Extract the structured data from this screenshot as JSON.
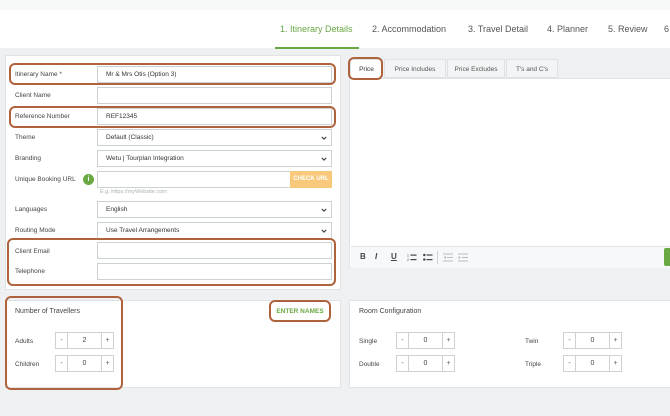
{
  "steps": [
    {
      "label": "1. Itinerary Details"
    },
    {
      "label": "2. Accommodation"
    },
    {
      "label": "3. Travel Detail"
    },
    {
      "label": "4. Planner"
    },
    {
      "label": "5. Review"
    },
    {
      "label": "6"
    }
  ],
  "form": {
    "itinerary_name_label": "Itinerary Name *",
    "itinerary_name_value": "Mr & Mrs Otis (Option 3)",
    "client_name_label": "Client Name",
    "reference_label": "Reference Number",
    "reference_value": "REF12345",
    "theme_label": "Theme",
    "theme_value": "Default (Classic)",
    "branding_label": "Branding",
    "branding_value": "Wetu | Tourplan Integration",
    "booking_url_label": "Unique Booking URL",
    "booking_url_hint": "E.g. https://myWebsite.com",
    "check_url_label": "CHECK URL",
    "languages_label": "Languages",
    "languages_value": "English",
    "routing_label": "Routing Mode",
    "routing_value": "Use Travel Arrangements",
    "client_email_label": "Client Email",
    "telephone_label": "Telephone"
  },
  "price_tabs": [
    {
      "label": "Price"
    },
    {
      "label": "Price Includes"
    },
    {
      "label": "Price Excludes"
    },
    {
      "label": "T's and C's"
    }
  ],
  "editor_tools": {
    "bold": "B",
    "italic": "I",
    "underline": "U"
  },
  "travellers": {
    "title": "Number of Travellers",
    "enter_names": "ENTER NAMES",
    "adults_label": "Adults",
    "adults_value": "2",
    "children_label": "Children",
    "children_value": "0",
    "minus": "-",
    "plus": "+"
  },
  "rooms": {
    "title": "Room Configuration",
    "single_label": "Single",
    "single_value": "0",
    "double_label": "Double",
    "double_value": "0",
    "twin_label": "Twin",
    "twin_value": "0",
    "triple_label": "Triple",
    "triple_value": "0"
  },
  "colors": {
    "accent_green": "#69a843",
    "highlight_brown": "#b0623d",
    "check_url_orange": "#f8c97a"
  }
}
